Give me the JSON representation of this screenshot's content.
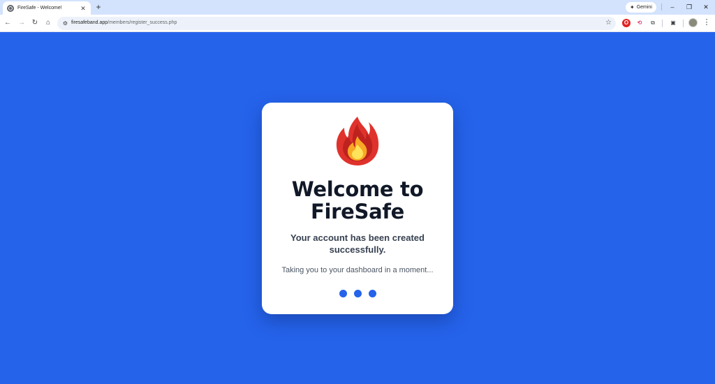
{
  "browser": {
    "tab": {
      "title": "FireSafe - Welcome!",
      "close_glyph": "✕",
      "favicon": "globe-icon"
    },
    "new_tab_glyph": "+",
    "gemini_label": "Gemini",
    "window_controls": {
      "minimize": "–",
      "restore": "❐",
      "close": "✕"
    },
    "nav": {
      "back": "←",
      "forward": "→",
      "reload": "↻",
      "home": "⌂"
    },
    "url": {
      "host": "firesafeband.app",
      "path": "/members/register_success.php"
    },
    "bookmark_glyph": "☆",
    "extensions": {
      "opera": "O",
      "pink": "⟲",
      "puzzle": "⧉",
      "panel": "▣"
    },
    "menu_glyph": "⋮"
  },
  "page": {
    "heading": "Welcome to FireSafe",
    "subheading": "Your account has been created successfully.",
    "message": "Taking you to your dashboard in a moment...",
    "loading_dots": 3,
    "colors": {
      "background": "#2563eb",
      "card": "#ffffff",
      "heading": "#111827",
      "dot": "#2563eb"
    }
  }
}
